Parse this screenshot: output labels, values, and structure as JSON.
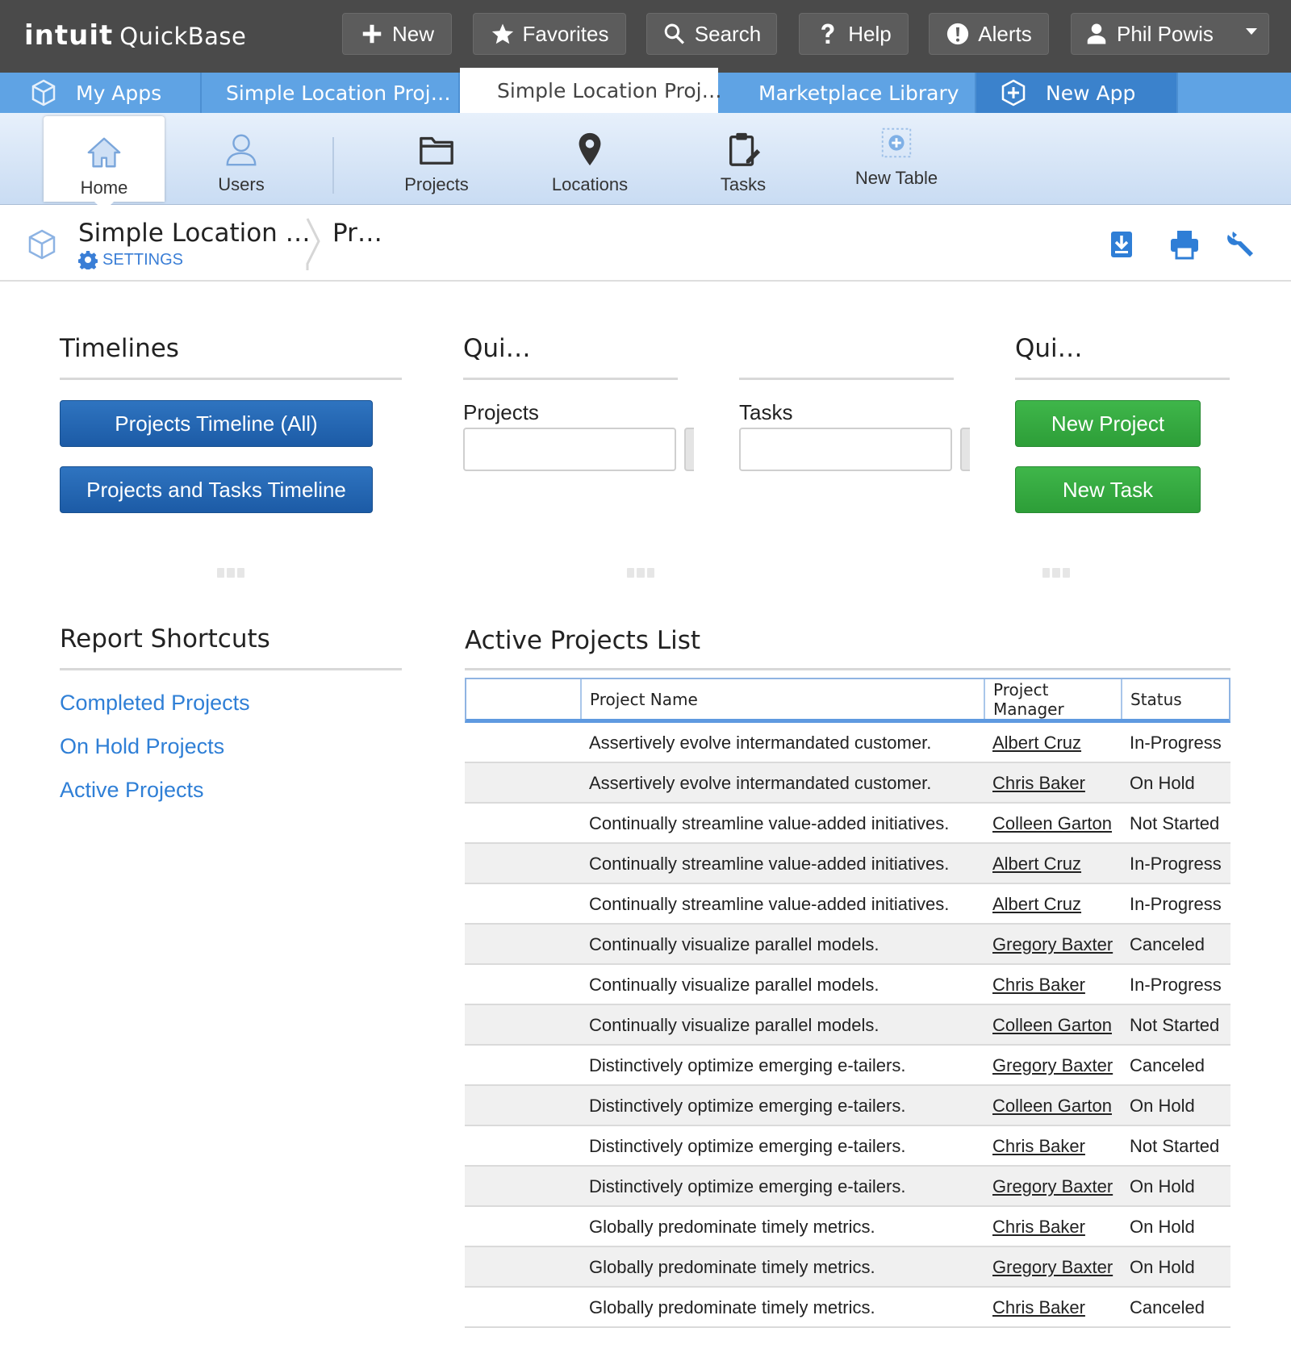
{
  "brand": {
    "logo": "intuit",
    "product": "QuickBase"
  },
  "global_bar": {
    "new": "New",
    "favorites": "Favorites",
    "search": "Search",
    "help": "Help",
    "alerts": "Alerts",
    "user": "Phil Powis"
  },
  "app_tabs": {
    "my_apps": "My Apps",
    "app1": "Simple Location Proj…",
    "app2": "Simple Location Proj…",
    "marketplace": "Marketplace Library",
    "new_app": "New App"
  },
  "table_nav": {
    "home": "Home",
    "users": "Users",
    "projects": "Projects",
    "locations": "Locations",
    "tasks": "Tasks",
    "new_table": "New Table"
  },
  "breadcrumb": {
    "app": "Simple Location …",
    "settings": "SETTINGS",
    "page": "Pr…"
  },
  "timelines": {
    "title": "Timelines",
    "btn_all": "Projects Timeline (All)",
    "btn_tasks": "Projects and Tasks Timeline"
  },
  "quick_search": {
    "title": "Qui…",
    "projects_label": "Projects",
    "tasks_label": "Tasks"
  },
  "quick_add": {
    "title": "Qui…",
    "new_project": "New Project",
    "new_task": "New Task"
  },
  "report_shortcuts": {
    "title": "Report Shortcuts",
    "links": [
      "Completed Projects",
      "On Hold Projects",
      "Active Projects"
    ]
  },
  "active_projects": {
    "title": "Active Projects List",
    "columns": [
      "Project Name",
      "Project Manager",
      "Status"
    ],
    "rows": [
      [
        "Assertively evolve intermandated customer.",
        "Albert Cruz",
        "In-Progress"
      ],
      [
        "Assertively evolve intermandated customer.",
        "Chris Baker",
        "On Hold"
      ],
      [
        "Continually streamline value-added initiatives.",
        "Colleen Garton",
        "Not Started"
      ],
      [
        "Continually streamline value-added initiatives.",
        "Albert Cruz",
        "In-Progress"
      ],
      [
        "Continually streamline value-added initiatives.",
        "Albert Cruz",
        "In-Progress"
      ],
      [
        "Continually visualize parallel models.",
        "Gregory Baxter",
        "Canceled"
      ],
      [
        "Continually visualize parallel models.",
        "Chris Baker",
        "In-Progress"
      ],
      [
        "Continually visualize parallel models.",
        "Colleen Garton",
        "Not Started"
      ],
      [
        "Distinctively optimize emerging e-tailers.",
        "Gregory Baxter",
        "Canceled"
      ],
      [
        "Distinctively optimize emerging e-tailers.",
        "Colleen Garton",
        "On Hold"
      ],
      [
        "Distinctively optimize emerging e-tailers.",
        "Chris Baker",
        "Not Started"
      ],
      [
        "Distinctively optimize emerging e-tailers.",
        "Gregory Baxter",
        "On Hold"
      ],
      [
        "Globally predominate timely metrics.",
        "Chris Baker",
        "On Hold"
      ],
      [
        "Globally predominate timely metrics.",
        "Gregory Baxter",
        "On Hold"
      ],
      [
        "Globally predominate timely metrics.",
        "Chris Baker",
        "Canceled"
      ]
    ]
  },
  "icons": {
    "new": "plus-icon",
    "favorites": "star-icon",
    "search": "search-icon",
    "help": "question-icon",
    "alerts": "alert-icon",
    "user": "user-icon",
    "apps": "cube-icon",
    "new_app": "add-app-icon",
    "home": "home-icon",
    "users": "users-icon",
    "projects": "folder-icon",
    "locations": "pin-icon",
    "tasks": "clipboard-icon",
    "new_table": "add-table-icon",
    "settings": "gear-icon",
    "download": "download-icon",
    "print": "print-icon",
    "customize": "wrench-icon"
  },
  "colors": {
    "topbar": "#4a4a4a",
    "tabbar": "#5fa3e4",
    "primary_button": "#1c5ba6",
    "success_button": "#2d9e38",
    "link": "#2f7fd6"
  }
}
